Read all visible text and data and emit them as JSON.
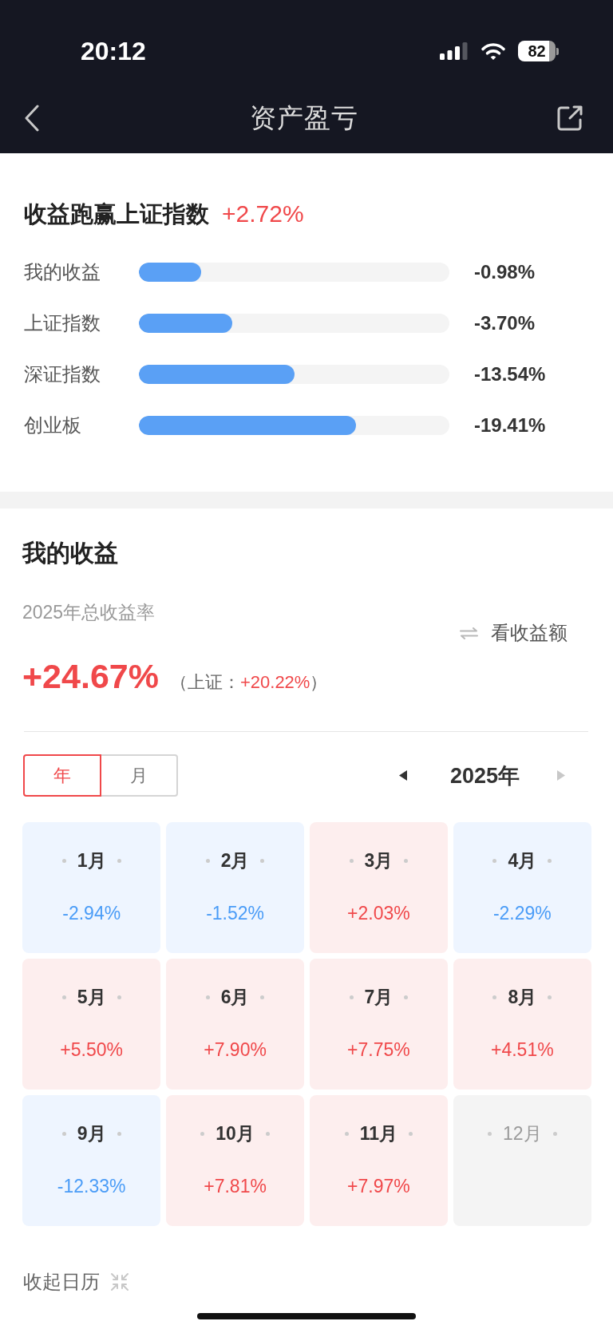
{
  "status_bar": {
    "time": "20:12",
    "battery": "82"
  },
  "nav": {
    "title": "资产盈亏"
  },
  "comparison": {
    "title": "收益跑赢上证指数",
    "lead": "+2.72%",
    "rows": [
      {
        "label": "我的收益",
        "level": 0.2,
        "reading": "-0.98%"
      },
      {
        "label": "上证指数",
        "level": 0.3,
        "reading": "-3.70%"
      },
      {
        "label": "深证指数",
        "level": 0.5,
        "reading": "-13.54%"
      },
      {
        "label": "创业板",
        "level": 0.7,
        "reading": "-19.41%"
      }
    ]
  },
  "my_returns": {
    "title": "我的收益",
    "rate_label": "2025年总收益率",
    "switch_label": "看收益额",
    "total": "+24.67%",
    "benchmark": {
      "prefix": "（上证：",
      "value": "+20.22%",
      "suffix": "）"
    },
    "view_tabs": [
      {
        "label": "年",
        "selected": true
      },
      {
        "label": "月",
        "selected": false
      }
    ],
    "year_nav": {
      "year": "2025年",
      "prev_disabled": false,
      "next_disabled": true
    },
    "months": [
      {
        "label": "1月",
        "value": "-2.94%",
        "kind": "loss"
      },
      {
        "label": "2月",
        "value": "-1.52%",
        "kind": "loss"
      },
      {
        "label": "3月",
        "value": "+2.03%",
        "kind": "gain"
      },
      {
        "label": "4月",
        "value": "-2.29%",
        "kind": "loss"
      },
      {
        "label": "5月",
        "value": "+5.50%",
        "kind": "gain"
      },
      {
        "label": "6月",
        "value": "+7.90%",
        "kind": "gain"
      },
      {
        "label": "7月",
        "value": "+7.75%",
        "kind": "gain"
      },
      {
        "label": "8月",
        "value": "+4.51%",
        "kind": "gain"
      },
      {
        "label": "9月",
        "value": "-12.33%",
        "kind": "loss"
      },
      {
        "label": "10月",
        "value": "+7.81%",
        "kind": "gain"
      },
      {
        "label": "11月",
        "value": "+7.97%",
        "kind": "gain"
      },
      {
        "label": "12月",
        "kind": "future"
      }
    ],
    "collapse_label": "收起日历"
  }
}
